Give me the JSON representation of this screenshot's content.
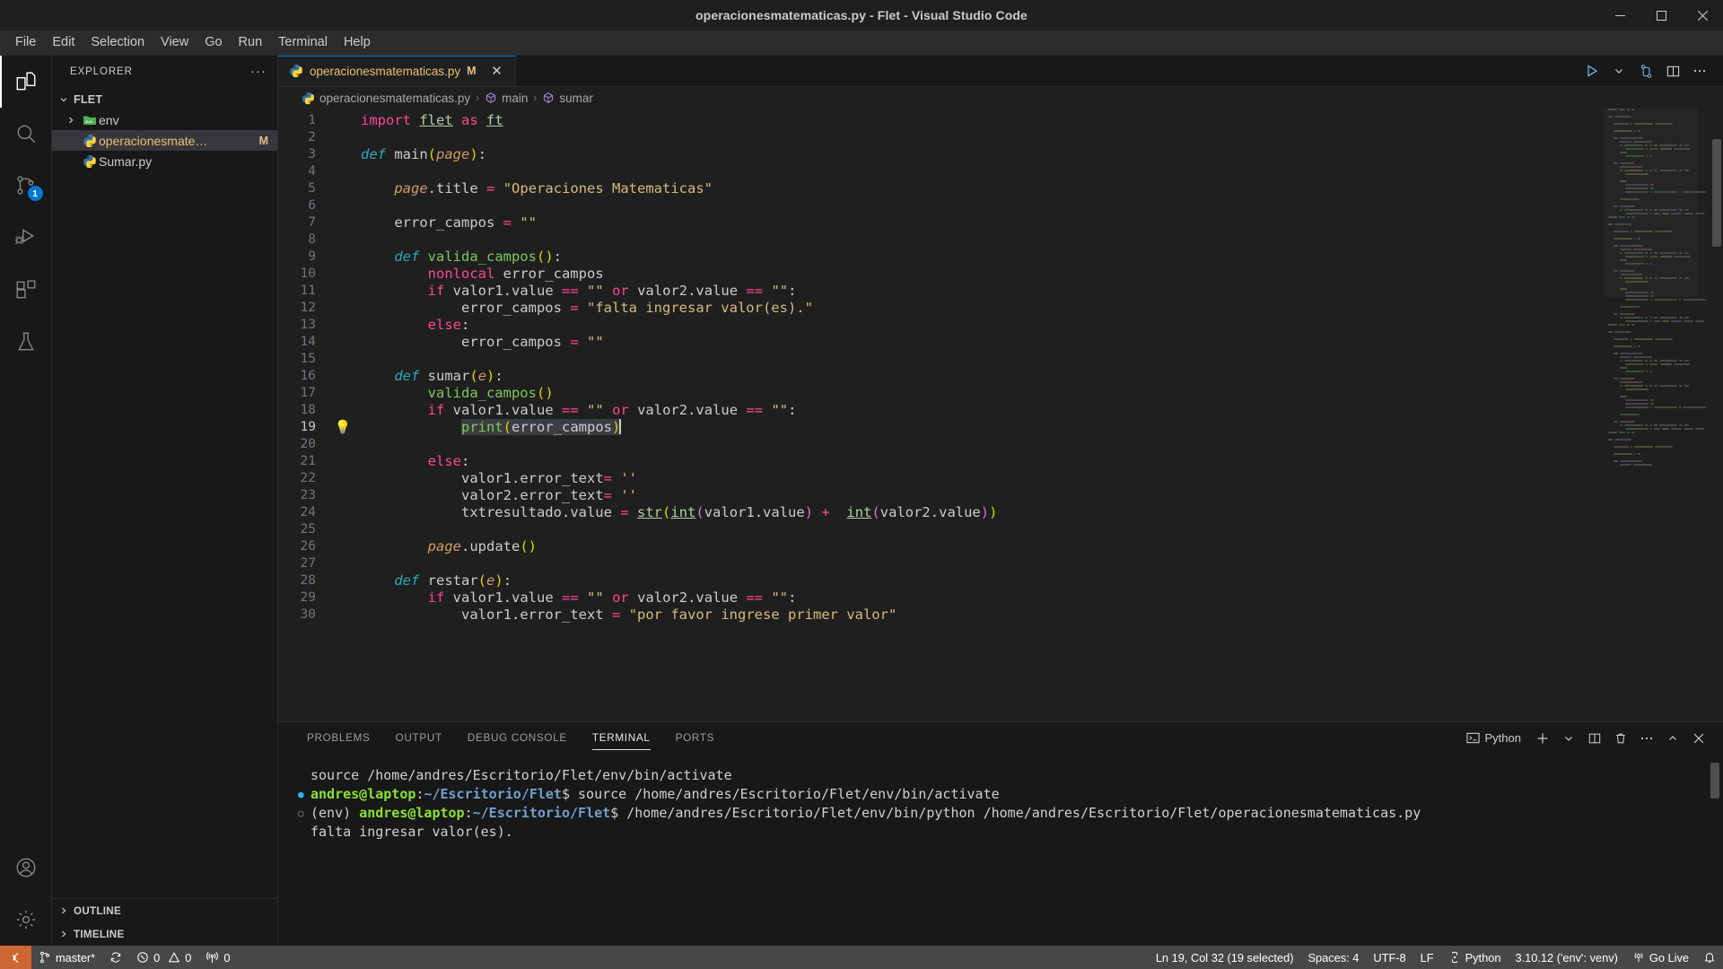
{
  "window": {
    "title": "operacionesmatematicas.py - Flet - Visual Studio Code",
    "minimize": "minimize-icon",
    "maximize": "maximize-icon",
    "close": "close-icon"
  },
  "menubar": {
    "items": [
      "File",
      "Edit",
      "Selection",
      "View",
      "Go",
      "Run",
      "Terminal",
      "Help"
    ]
  },
  "activitybar": {
    "items": [
      {
        "name": "explorer",
        "icon": "files-icon",
        "active": true,
        "badge": ""
      },
      {
        "name": "search",
        "icon": "search-icon",
        "active": false,
        "badge": ""
      },
      {
        "name": "source-control",
        "icon": "source-control-icon",
        "active": false,
        "badge": "1"
      },
      {
        "name": "run-debug",
        "icon": "run-debug-icon",
        "active": false,
        "badge": ""
      },
      {
        "name": "extensions",
        "icon": "extensions-icon",
        "active": false,
        "badge": ""
      },
      {
        "name": "testing",
        "icon": "beaker-icon",
        "active": false,
        "badge": ""
      }
    ],
    "bottom": [
      {
        "name": "accounts",
        "icon": "account-icon"
      },
      {
        "name": "settings",
        "icon": "gear-icon"
      }
    ]
  },
  "sidebar": {
    "header": {
      "title": "EXPLORER",
      "more": "···"
    },
    "root": {
      "label": "FLET",
      "expanded": true
    },
    "items": [
      {
        "label": "env",
        "type": "folder",
        "expanded": false,
        "flag": "",
        "selected": false
      },
      {
        "label": "operacionesmate…",
        "type": "python",
        "flag": "M",
        "selected": true
      },
      {
        "label": "Sumar.py",
        "type": "python",
        "flag": "",
        "selected": false
      }
    ],
    "sections": [
      {
        "label": "OUTLINE"
      },
      {
        "label": "TIMELINE"
      }
    ]
  },
  "editor": {
    "tab": {
      "label": "operacionesmatematicas.py",
      "modified_flag": "M",
      "close": "✕",
      "icon": "python-icon"
    },
    "tab_actions": [
      {
        "name": "run-python-file",
        "icon": "play-icon"
      },
      {
        "name": "run-dropdown",
        "icon": "chevron-down-icon"
      },
      {
        "name": "run-and-debug",
        "icon": "split-run-icon"
      },
      {
        "name": "split-editor",
        "icon": "split-editor-icon"
      },
      {
        "name": "more-actions",
        "icon": "ellipsis-icon"
      }
    ],
    "breadcrumb": [
      "operacionesmatematicas.py",
      "main",
      "sumar"
    ],
    "cursor_line": 19,
    "lines": [
      {
        "n": 1,
        "text": "import flet as ft"
      },
      {
        "n": 2,
        "text": ""
      },
      {
        "n": 3,
        "text": "def main(page):"
      },
      {
        "n": 4,
        "text": ""
      },
      {
        "n": 5,
        "text": "    page.title = \"Operaciones Matematicas\""
      },
      {
        "n": 6,
        "text": ""
      },
      {
        "n": 7,
        "text": "    error_campos = \"\""
      },
      {
        "n": 8,
        "text": ""
      },
      {
        "n": 9,
        "text": "    def valida_campos():"
      },
      {
        "n": 10,
        "text": "        nonlocal error_campos"
      },
      {
        "n": 11,
        "text": "        if valor1.value == \"\" or valor2.value == \"\":"
      },
      {
        "n": 12,
        "text": "            error_campos = \"falta ingresar valor(es).\""
      },
      {
        "n": 13,
        "text": "        else:"
      },
      {
        "n": 14,
        "text": "            error_campos = \"\""
      },
      {
        "n": 15,
        "text": ""
      },
      {
        "n": 16,
        "text": "    def sumar(e):"
      },
      {
        "n": 17,
        "text": "        valida_campos()"
      },
      {
        "n": 18,
        "text": "        if valor1.value == \"\" or valor2.value == \"\":"
      },
      {
        "n": 19,
        "text": "            print(error_campos)"
      },
      {
        "n": 20,
        "text": ""
      },
      {
        "n": 21,
        "text": "        else:"
      },
      {
        "n": 22,
        "text": "            valor1.error_text= ''"
      },
      {
        "n": 23,
        "text": "            valor2.error_text= ''"
      },
      {
        "n": 24,
        "text": "            txtresultado.value = str(int(valor1.value) +  int(valor2.value))"
      },
      {
        "n": 25,
        "text": ""
      },
      {
        "n": 26,
        "text": "        page.update()"
      },
      {
        "n": 27,
        "text": ""
      },
      {
        "n": 28,
        "text": "    def restar(e):"
      },
      {
        "n": 29,
        "text": "        if valor1.value == \"\" or valor2.value == \"\":"
      },
      {
        "n": 30,
        "text": "            valor1.error_text = \"por favor ingrese primer valor\""
      }
    ],
    "lightbulb_line": 19,
    "selection_text": "print(error_campos)"
  },
  "panel": {
    "tabs": [
      {
        "label": "PROBLEMS",
        "active": false
      },
      {
        "label": "OUTPUT",
        "active": false
      },
      {
        "label": "DEBUG CONSOLE",
        "active": false
      },
      {
        "label": "TERMINAL",
        "active": true
      },
      {
        "label": "PORTS",
        "active": false
      }
    ],
    "shell_selector": {
      "label": "Python",
      "icon": "terminal-icon"
    },
    "actions": [
      {
        "name": "new-terminal",
        "icon": "plus-icon"
      },
      {
        "name": "terminal-dropdown",
        "icon": "chevron-down-icon"
      },
      {
        "name": "split-terminal",
        "icon": "split-icon"
      },
      {
        "name": "kill-terminal",
        "icon": "trash-icon"
      },
      {
        "name": "panel-more",
        "icon": "ellipsis-icon"
      },
      {
        "name": "maximize-panel",
        "icon": "chevron-up-icon"
      },
      {
        "name": "close-panel",
        "icon": "close-icon"
      }
    ],
    "terminal_lines": [
      {
        "marker": "",
        "segments": [
          {
            "t": "source /home/andres/Escritorio/Flet/env/bin/activate",
            "c": "plain"
          }
        ]
      },
      {
        "marker": "filled",
        "segments": [
          {
            "t": "andres@laptop",
            "c": "green"
          },
          {
            "t": ":",
            "c": "plain"
          },
          {
            "t": "~/Escritorio/Flet",
            "c": "blue"
          },
          {
            "t": "$ source /home/andres/Escritorio/Flet/env/bin/activate",
            "c": "plain"
          }
        ]
      },
      {
        "marker": "hollow",
        "segments": [
          {
            "t": "(env) ",
            "c": "plain"
          },
          {
            "t": "andres@laptop",
            "c": "green"
          },
          {
            "t": ":",
            "c": "plain"
          },
          {
            "t": "~/Escritorio/Flet",
            "c": "blue"
          },
          {
            "t": "$ /home/andres/Escritorio/Flet/env/bin/python /home/andres/Escritorio/Flet/operacionesmatematicas.py",
            "c": "plain"
          }
        ]
      },
      {
        "marker": "",
        "segments": [
          {
            "t": "falta ingresar valor(es).",
            "c": "plain"
          }
        ]
      }
    ]
  },
  "statusbar": {
    "remote": {
      "icon": "remote-icon",
      "label": ""
    },
    "left": [
      {
        "name": "branch",
        "icon": "git-branch-icon",
        "label": "master*"
      },
      {
        "name": "sync",
        "icon": "sync-icon",
        "label": ""
      },
      {
        "name": "problems",
        "icon": "error-warning-icon",
        "label": "0  0",
        "errors": "0",
        "warnings": "0"
      },
      {
        "name": "ports",
        "icon": "radio-tower-icon",
        "label": "0"
      }
    ],
    "right": [
      {
        "name": "cursor-position",
        "label": "Ln 19, Col 32 (19 selected)"
      },
      {
        "name": "indentation",
        "label": "Spaces: 4"
      },
      {
        "name": "encoding",
        "label": "UTF-8"
      },
      {
        "name": "eol",
        "label": "LF"
      },
      {
        "name": "language-mode",
        "label": "Python",
        "icon": "python-small-icon"
      },
      {
        "name": "interpreter",
        "label": "3.10.12 ('env': venv)"
      },
      {
        "name": "go-live",
        "label": "Go Live",
        "icon": "broadcast-icon"
      },
      {
        "name": "notifications",
        "label": "",
        "icon": "bell-icon"
      }
    ]
  },
  "colors": {
    "accent": "#0078d4",
    "remote_bg": "#cc6633",
    "status_bg": "#474747",
    "editor_bg": "#1f1f1f",
    "sidebar_bg": "#181818",
    "modified": "#e2c08d",
    "badge": "#0078d4"
  }
}
